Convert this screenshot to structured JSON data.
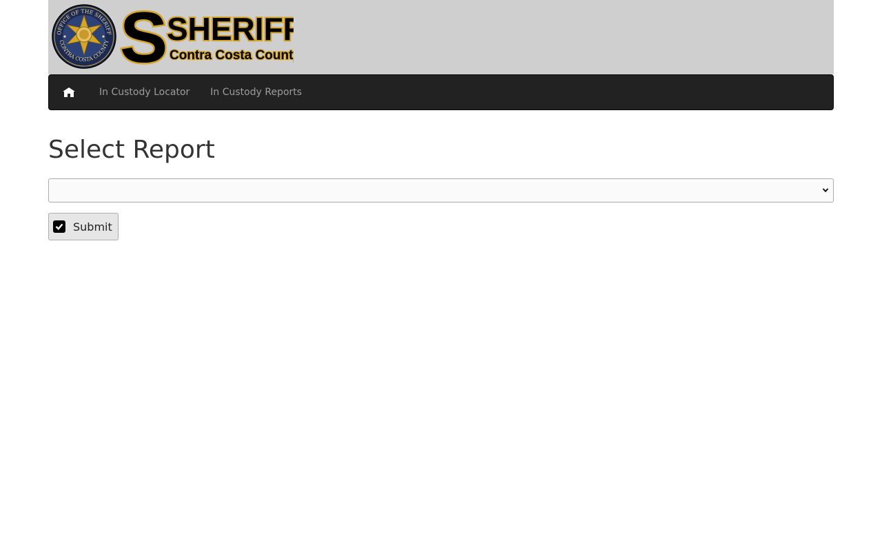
{
  "header": {
    "seal_text_top": "OFFICE OF THE SHERIFF",
    "seal_text_bottom": "CONTRA COSTA COUNTY",
    "wordmark_title": "SHERIFF",
    "wordmark_subtitle": "Contra Costa County"
  },
  "nav": {
    "home_icon": "home-icon",
    "items": [
      {
        "label": "In Custody Locator"
      },
      {
        "label": "In Custody Reports"
      }
    ]
  },
  "main": {
    "title": "Select Report",
    "select_value": "",
    "submit_label": "Submit",
    "submit_checked": true
  },
  "colors": {
    "banner_bg": "#cfcfcf",
    "navbar_bg": "#222222",
    "nav_link": "#9d9d9d",
    "gold": "#d4a52a"
  }
}
